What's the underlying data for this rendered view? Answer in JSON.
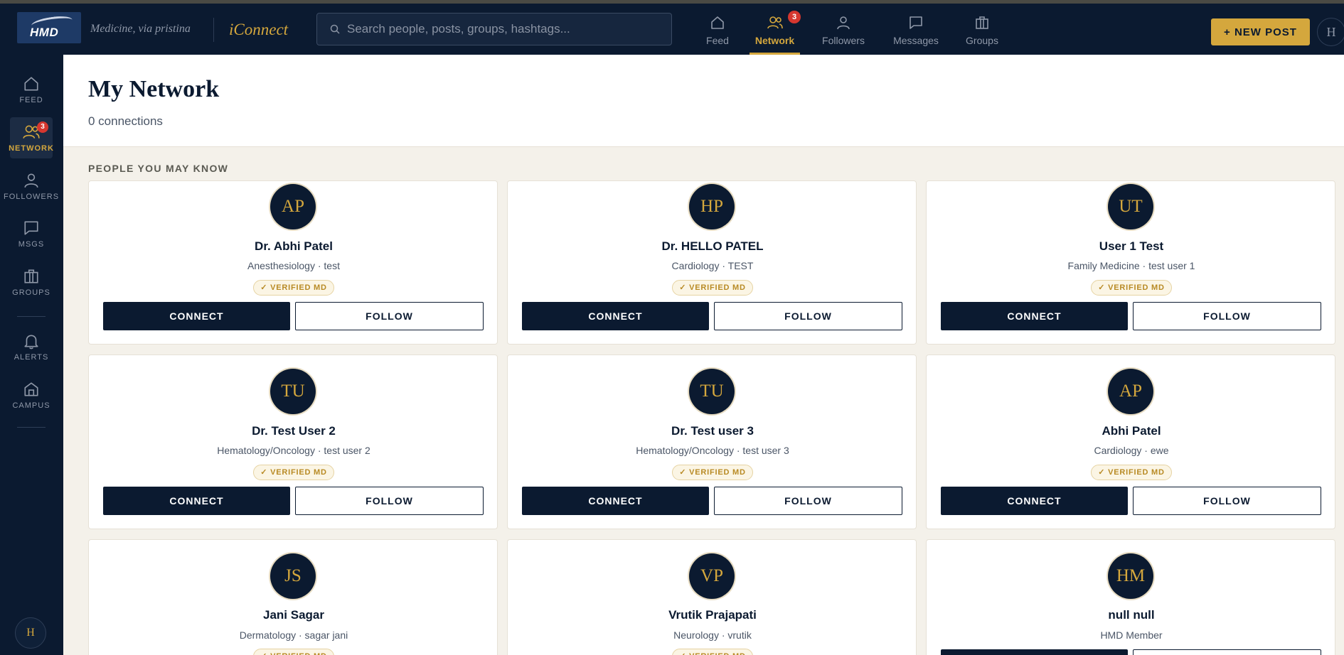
{
  "brand": {
    "logo_text": "HMD",
    "tagline": "Medicine, via pristina",
    "app_name": "iConnect"
  },
  "search": {
    "placeholder": "Search people, posts, groups, hashtags..."
  },
  "top_nav": [
    {
      "label": "Feed",
      "icon": "home-icon"
    },
    {
      "label": "Network",
      "icon": "people-icon",
      "badge": "3",
      "active": true
    },
    {
      "label": "Followers",
      "icon": "person-icon"
    },
    {
      "label": "Messages",
      "icon": "message-icon"
    },
    {
      "label": "Groups",
      "icon": "briefcase-icon"
    }
  ],
  "new_post": {
    "label": "NEW POST",
    "icon_glyph": "+"
  },
  "user_avatar": "H",
  "sidebar": [
    {
      "label": "FEED",
      "icon": "home-icon"
    },
    {
      "label": "NETWORK",
      "icon": "people-icon",
      "badge": "3",
      "active": true
    },
    {
      "label": "FOLLOWERS",
      "icon": "person-icon"
    },
    {
      "label": "MSGS",
      "icon": "message-icon"
    },
    {
      "label": "GROUPS",
      "icon": "briefcase-icon"
    },
    {
      "label": "ALERTS",
      "icon": "bell-icon"
    },
    {
      "label": "CAMPUS",
      "icon": "campus-icon"
    }
  ],
  "page": {
    "title": "My Network",
    "connections": "0 connections",
    "section": "PEOPLE YOU MAY KNOW"
  },
  "people": [
    {
      "initials": "AP",
      "name": "Dr. Abhi Patel",
      "meta": "Anesthesiology · test",
      "verified": "✓ VERIFIED MD"
    },
    {
      "initials": "HP",
      "name": "Dr. HELLO PATEL",
      "meta": "Cardiology · TEST",
      "verified": "✓ VERIFIED MD"
    },
    {
      "initials": "UT",
      "name": "User 1 Test",
      "meta": "Family Medicine · test user 1",
      "verified": "✓ VERIFIED MD"
    },
    {
      "initials": "TU",
      "name": "Dr. Test User 2",
      "meta": "Hematology/Oncology · test user 2",
      "verified": "✓ VERIFIED MD"
    },
    {
      "initials": "TU",
      "name": "Dr. Test user 3",
      "meta": "Hematology/Oncology · test user 3",
      "verified": "✓ VERIFIED MD"
    },
    {
      "initials": "AP",
      "name": "Abhi Patel",
      "meta": "Cardiology · ewe",
      "verified": "✓ VERIFIED MD"
    },
    {
      "initials": "JS",
      "name": "Jani Sagar",
      "meta": "Dermatology · sagar jani",
      "verified": "✓ VERIFIED MD"
    },
    {
      "initials": "VP",
      "name": "Vrutik Prajapati",
      "meta": "Neurology · vrutik",
      "verified": "✓ VERIFIED MD"
    },
    {
      "initials": "HM",
      "name": "null null",
      "meta": "HMD Member",
      "verified": ""
    }
  ],
  "actions": {
    "connect": "CONNECT",
    "follow": "FOLLOW"
  },
  "colors": {
    "navy": "#0b1a30",
    "gold": "#d4a73d",
    "badge_red": "#d6372f",
    "page_bg": "#f4f1ea"
  }
}
